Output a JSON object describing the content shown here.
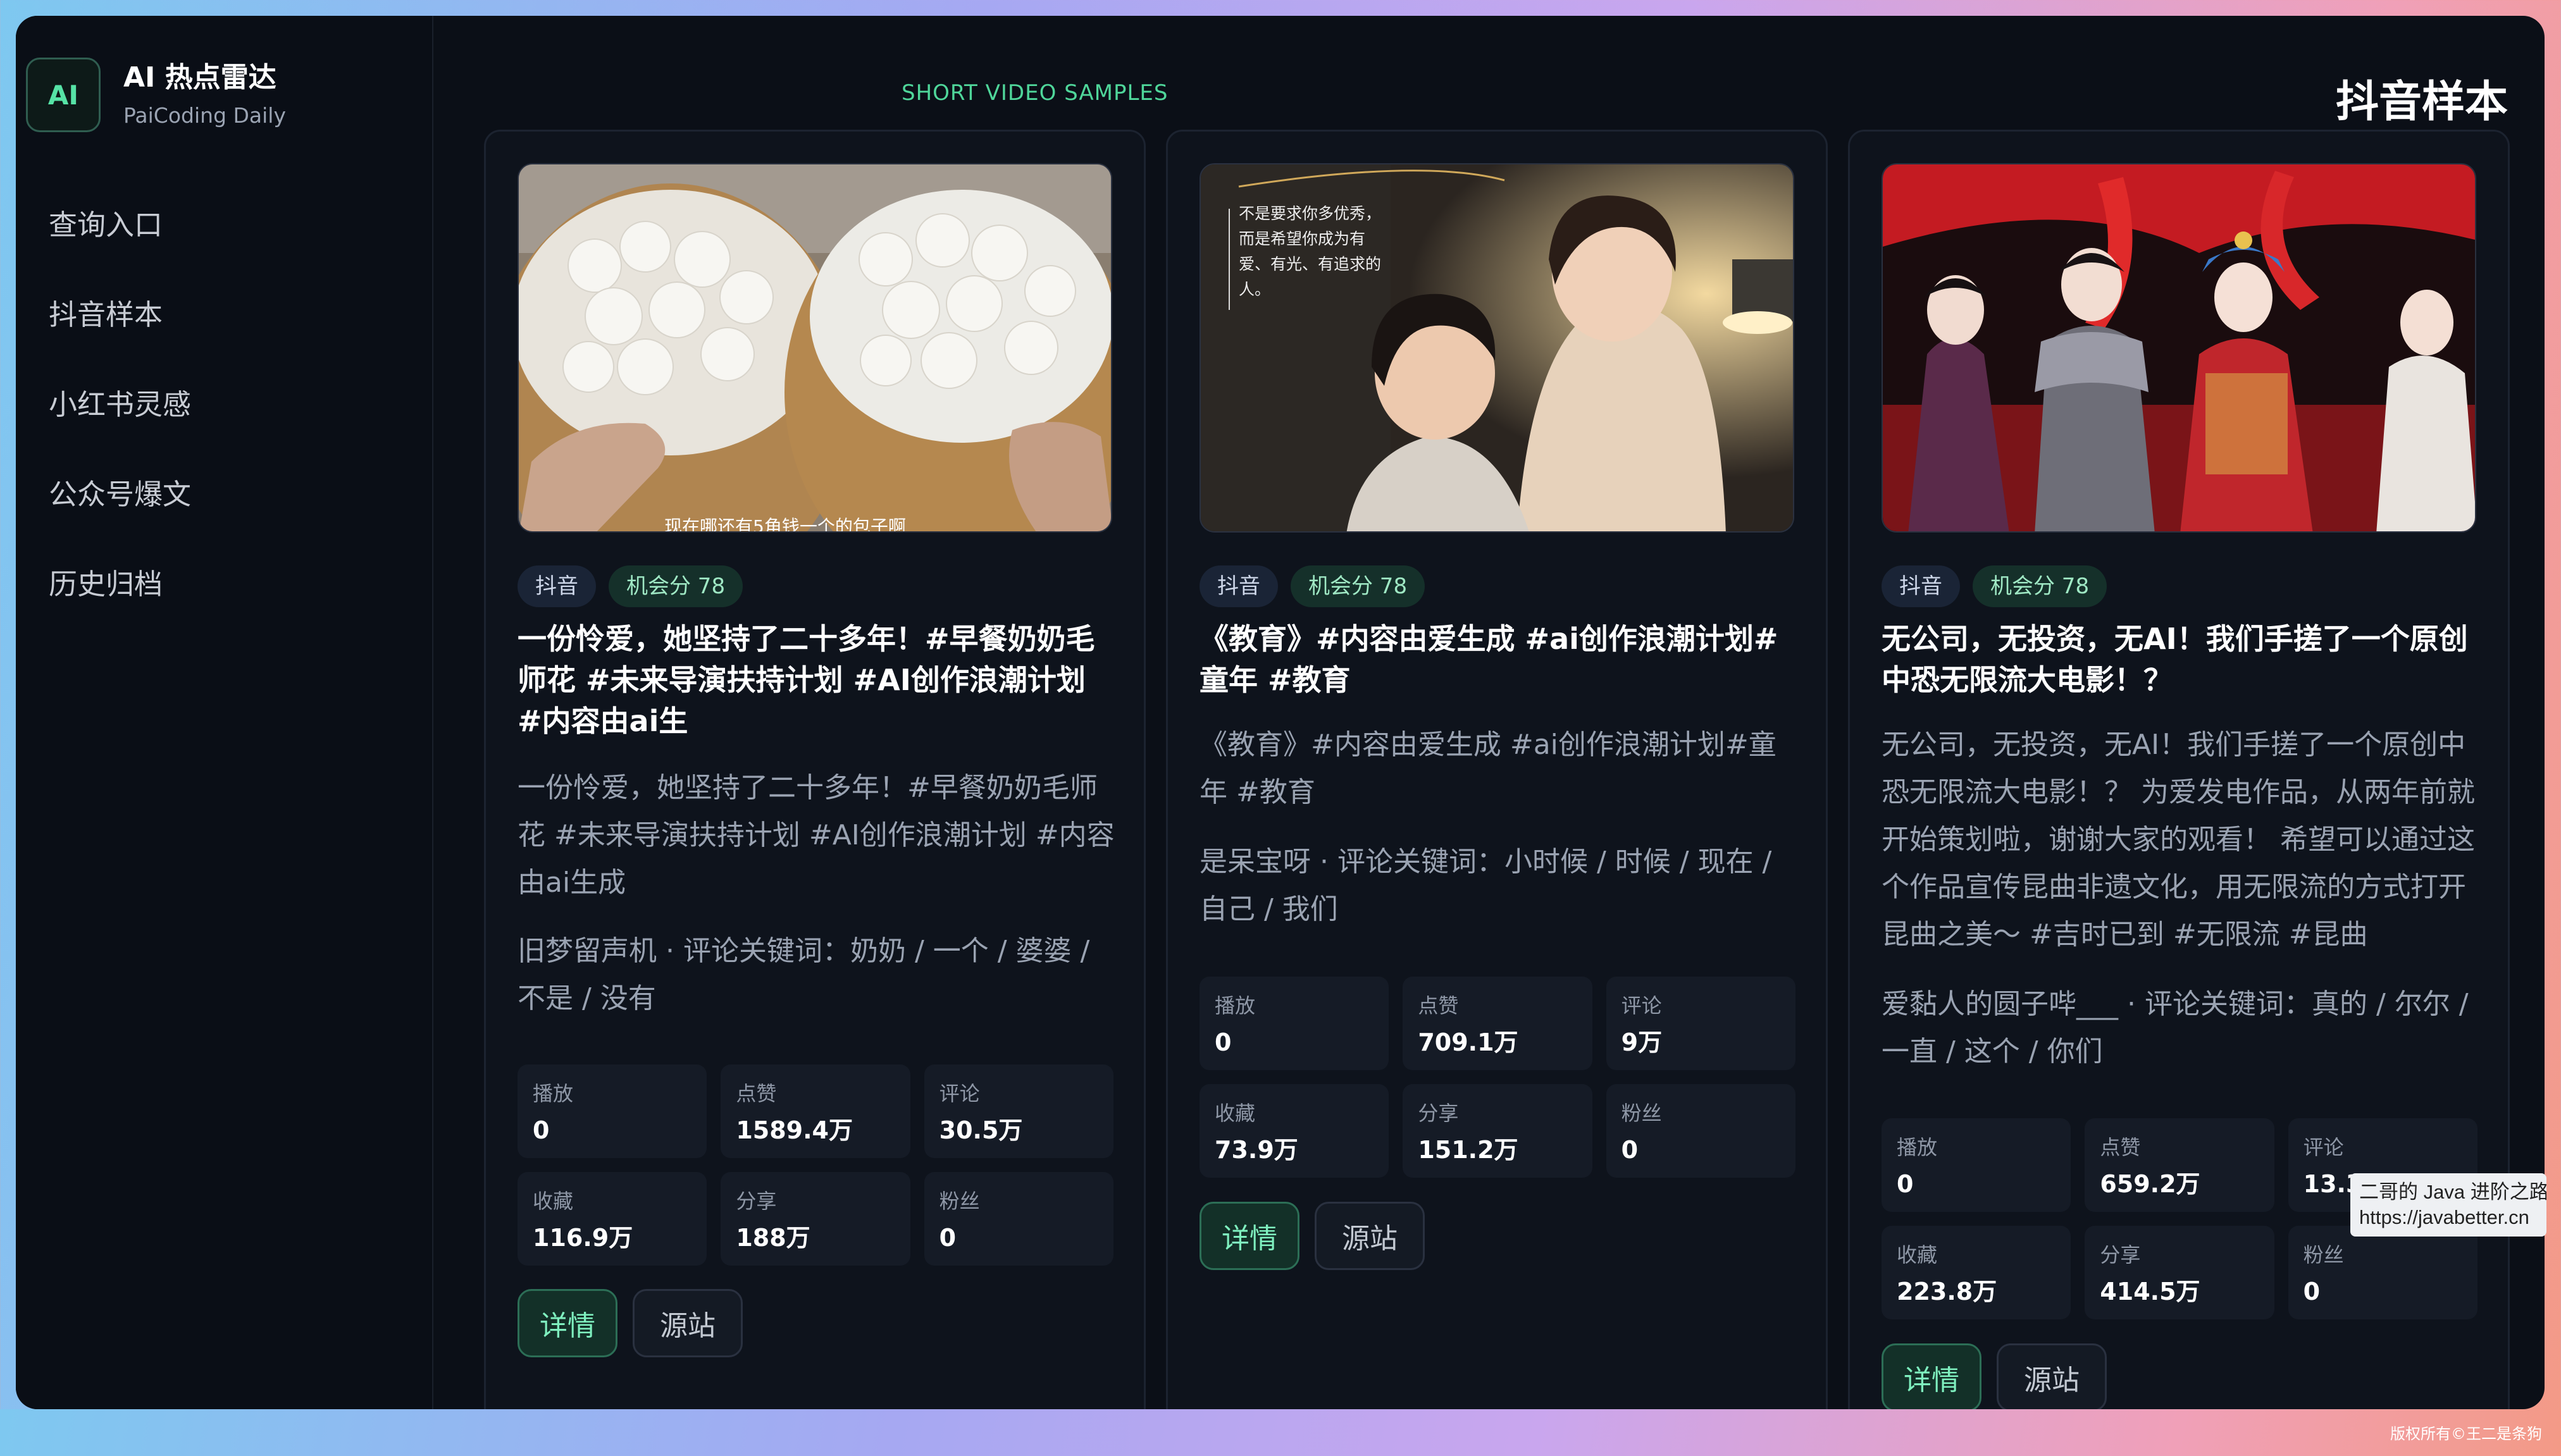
{
  "brand": {
    "logo": "AI",
    "title": "AI 热点雷达",
    "subtitle": "PaiCoding Daily"
  },
  "nav": {
    "items": [
      {
        "label": "查询入口"
      },
      {
        "label": "抖音样本"
      },
      {
        "label": "小红书灵感"
      },
      {
        "label": "公众号爆文"
      },
      {
        "label": "历史归档"
      }
    ]
  },
  "header": {
    "kicker": "SHORT VIDEO SAMPLES",
    "title": "抖音样本"
  },
  "cards": [
    {
      "thumbnail_caption": "现在哪还有5角钱一个的包子啊",
      "tag_platform": "抖音",
      "tag_score": "机会分 78",
      "title": "一份怜爱，她坚持了二十多年！#早餐奶奶毛师花 #未来导演扶持计划 #AI创作浪潮计划 #内容由ai生",
      "description": "一份怜爱，她坚持了二十多年！#早餐奶奶毛师花 #未来导演扶持计划 #AI创作浪潮计划 #内容由ai生成",
      "meta": "旧梦留声机 · 评论关键词：奶奶 / 一个 / 婆婆 / 不是 / 没有",
      "stats": [
        {
          "label": "播放",
          "value": "0"
        },
        {
          "label": "点赞",
          "value": "1589.4万"
        },
        {
          "label": "评论",
          "value": "30.5万"
        },
        {
          "label": "收藏",
          "value": "116.9万"
        },
        {
          "label": "分享",
          "value": "188万"
        },
        {
          "label": "粉丝",
          "value": "0"
        }
      ],
      "detail_label": "详情",
      "source_label": "源站"
    },
    {
      "thumbnail_caption": "不是要求你多优秀，而是希望你成为有爱、有光、有追求的人。",
      "tag_platform": "抖音",
      "tag_score": "机会分 78",
      "title": "《教育》#内容由爱生成 #ai创作浪潮计划#童年 #教育",
      "description": "《教育》#内容由爱生成 #ai创作浪潮计划#童年 #教育",
      "meta": "是呆宝呀 · 评论关键词：小时候 / 时候 / 现在 / 自己 / 我们",
      "stats": [
        {
          "label": "播放",
          "value": "0"
        },
        {
          "label": "点赞",
          "value": "709.1万"
        },
        {
          "label": "评论",
          "value": "9万"
        },
        {
          "label": "收藏",
          "value": "73.9万"
        },
        {
          "label": "分享",
          "value": "151.2万"
        },
        {
          "label": "粉丝",
          "value": "0"
        }
      ],
      "detail_label": "详情",
      "source_label": "源站"
    },
    {
      "thumbnail_caption": "",
      "tag_platform": "抖音",
      "tag_score": "机会分 78",
      "title": "无公司，无投资，无AI！我们手搓了一个原创中恐无限流大电影！？",
      "description": "无公司，无投资，无AI！我们手搓了一个原创中恐无限流大电影！？ 为爱发电作品，从两年前就开始策划啦，谢谢大家的观看！ 希望可以通过这个作品宣传昆曲非遗文化，用无限流的方式打开昆曲之美～ #吉时已到 #无限流 #昆曲",
      "meta": "爱黏人的圆子哔___ · 评论关键词：真的 / 尔尔 / 一直 / 这个 / 你们",
      "stats": [
        {
          "label": "播放",
          "value": "0"
        },
        {
          "label": "点赞",
          "value": "659.2万"
        },
        {
          "label": "评论",
          "value": "13.3万"
        },
        {
          "label": "收藏",
          "value": "223.8万"
        },
        {
          "label": "分享",
          "value": "414.5万"
        },
        {
          "label": "粉丝",
          "value": "0"
        }
      ],
      "detail_label": "详情",
      "source_label": "源站"
    }
  ],
  "tooltip": {
    "line1": "二哥的 Java 进阶之路",
    "line2": "https://javabetter.cn"
  },
  "copyright": "版权所有©王二是条狗"
}
